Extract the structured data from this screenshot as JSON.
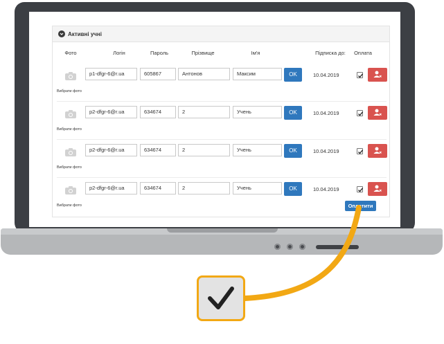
{
  "panel": {
    "title": "Активні учні"
  },
  "table": {
    "headers": {
      "photo": "Фото",
      "login": "Логін",
      "password": "Пароль",
      "surname": "Прізвище",
      "name": "Ім'я",
      "subscription": "Підписка до:",
      "payment": "Оплата"
    },
    "rows": [
      {
        "pick_photo": "Вибрати фото",
        "login": "p1-dfgr-6@r.ua",
        "password": "605867",
        "surname": "Антонов",
        "name": "Максим",
        "ok": "OK",
        "date": "10.04.2019",
        "paid": true
      },
      {
        "pick_photo": "Вибрати фото",
        "login": "p2-dfgr-6@r.ua",
        "password": "634674",
        "surname": "2",
        "name": "Учень",
        "ok": "OK",
        "date": "10.04.2019",
        "paid": true
      },
      {
        "pick_photo": "Вибрати фото",
        "login": "p2-dfgr-6@r.ua",
        "password": "634674",
        "surname": "2",
        "name": "Учень",
        "ok": "OK",
        "date": "10.04.2019",
        "paid": true
      },
      {
        "pick_photo": "Вибрати фото",
        "login": "p2-dfgr-6@r.ua",
        "password": "634674",
        "surname": "2",
        "name": "Учень",
        "ok": "OK",
        "date": "10.04.2019",
        "paid": true
      }
    ]
  },
  "pay_button": "Оплатити",
  "colors": {
    "primary": "#2f78bd",
    "danger": "#d9534f",
    "accent": "#f2a814",
    "laptop_frame": "#3c3f44"
  },
  "icons": {
    "collapse": "chevron-down-icon",
    "photo": "camera-icon",
    "delete": "remove-user-icon",
    "checkbox": "checkmark-icon"
  }
}
